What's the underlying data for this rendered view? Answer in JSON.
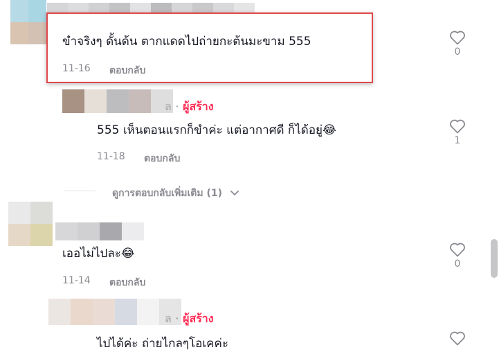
{
  "comments": [
    {
      "text": "ขำจริงๆ ดั้นด้น ตากแดดไปถ่ายกะต้นมะขาม 555",
      "date": "11-16",
      "reply_label": "ตอบกลับ",
      "likes": "0"
    },
    {
      "creator_badge": "ผู้สร้าง",
      "name_tail": "ล",
      "separator": "·",
      "text": "555 เห็นตอนแรกก็ขำค่ะ แต่อากาศดี ก็ได้อยู่😂",
      "date": "11-18",
      "reply_label": "ตอบกลับ",
      "likes": "1"
    },
    {
      "view_more": "ดูการตอบกลับเพิ่มเติม (1)"
    },
    {
      "text": "เออไม่ไปละ😂",
      "date": "11-14",
      "reply_label": "ตอบกลับ",
      "likes": "0"
    },
    {
      "creator_badge": "ผู้สร้าง",
      "name_tail": "ล",
      "separator": "·",
      "text": "ไปได้ค่ะ ถ่ายไกลๆโอเคค่ะ"
    }
  ],
  "colors": {
    "creator": "#fe2c55",
    "highlight_border": "#e0484a",
    "muted": "#8a8b91",
    "text": "#161823"
  },
  "icons": {
    "like": "heart-outline-icon",
    "expand": "chevron-down-icon"
  }
}
